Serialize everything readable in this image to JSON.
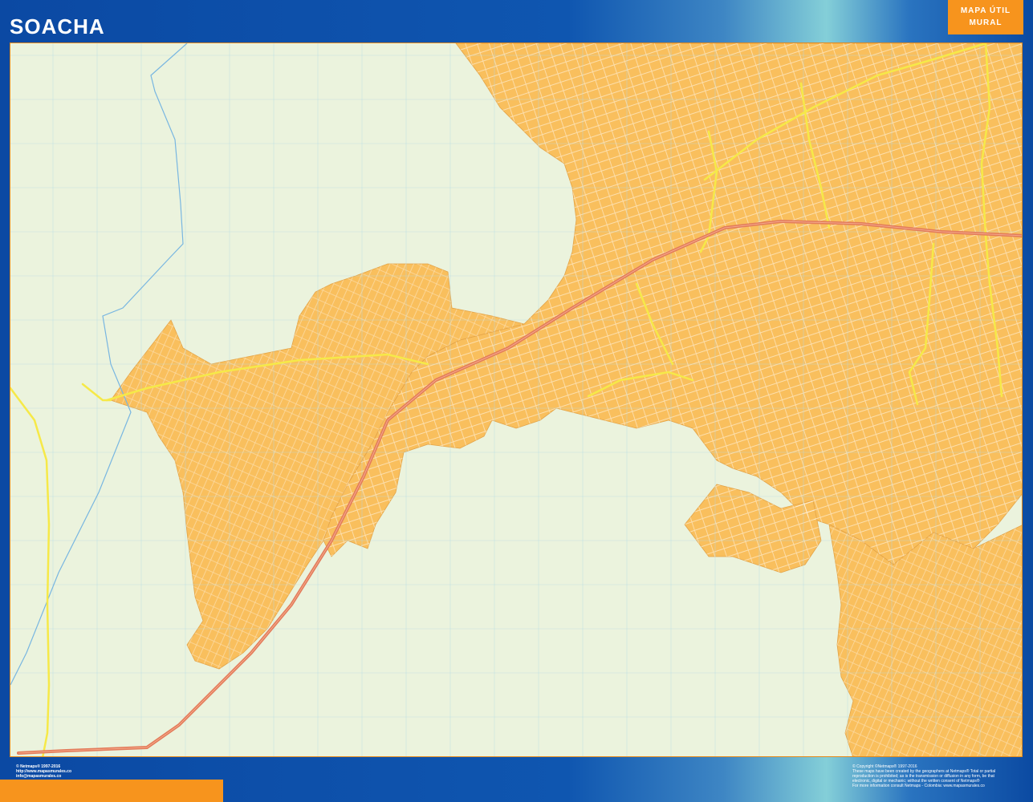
{
  "map": {
    "title": "SOACHA",
    "badge_line1": "MAPA ÚTIL",
    "badge_line2": "MURAL",
    "colors": {
      "urban": "#f9bf5d",
      "background": "#ebf3dd",
      "grid": "#b6dbe6",
      "highway": "#e27b5a",
      "yellow_road": "#f6e948",
      "river": "#78b6e1",
      "frame": "#0b49a3",
      "accent": "#f7941d"
    }
  },
  "footer": {
    "left_line1": "© Netmaps® 1997-2016",
    "left_line2": "http://www.mapasmurales.co",
    "left_line3": "info@mapasmurales.co",
    "right_line1": "© Copyright ©Netmaps® 1997-2016",
    "right_line2": "These maps have been created by the geographers at Netmaps® Total or partial",
    "right_line3": "reproduction is prohibited; as is the transmission or diffusion in any form, be that",
    "right_line4": "electronic, digital or mechanic; without the written consent of Netmaps®",
    "right_line5": "For more information consult Netmaps - Colombia: www.mapasmurales.co"
  }
}
